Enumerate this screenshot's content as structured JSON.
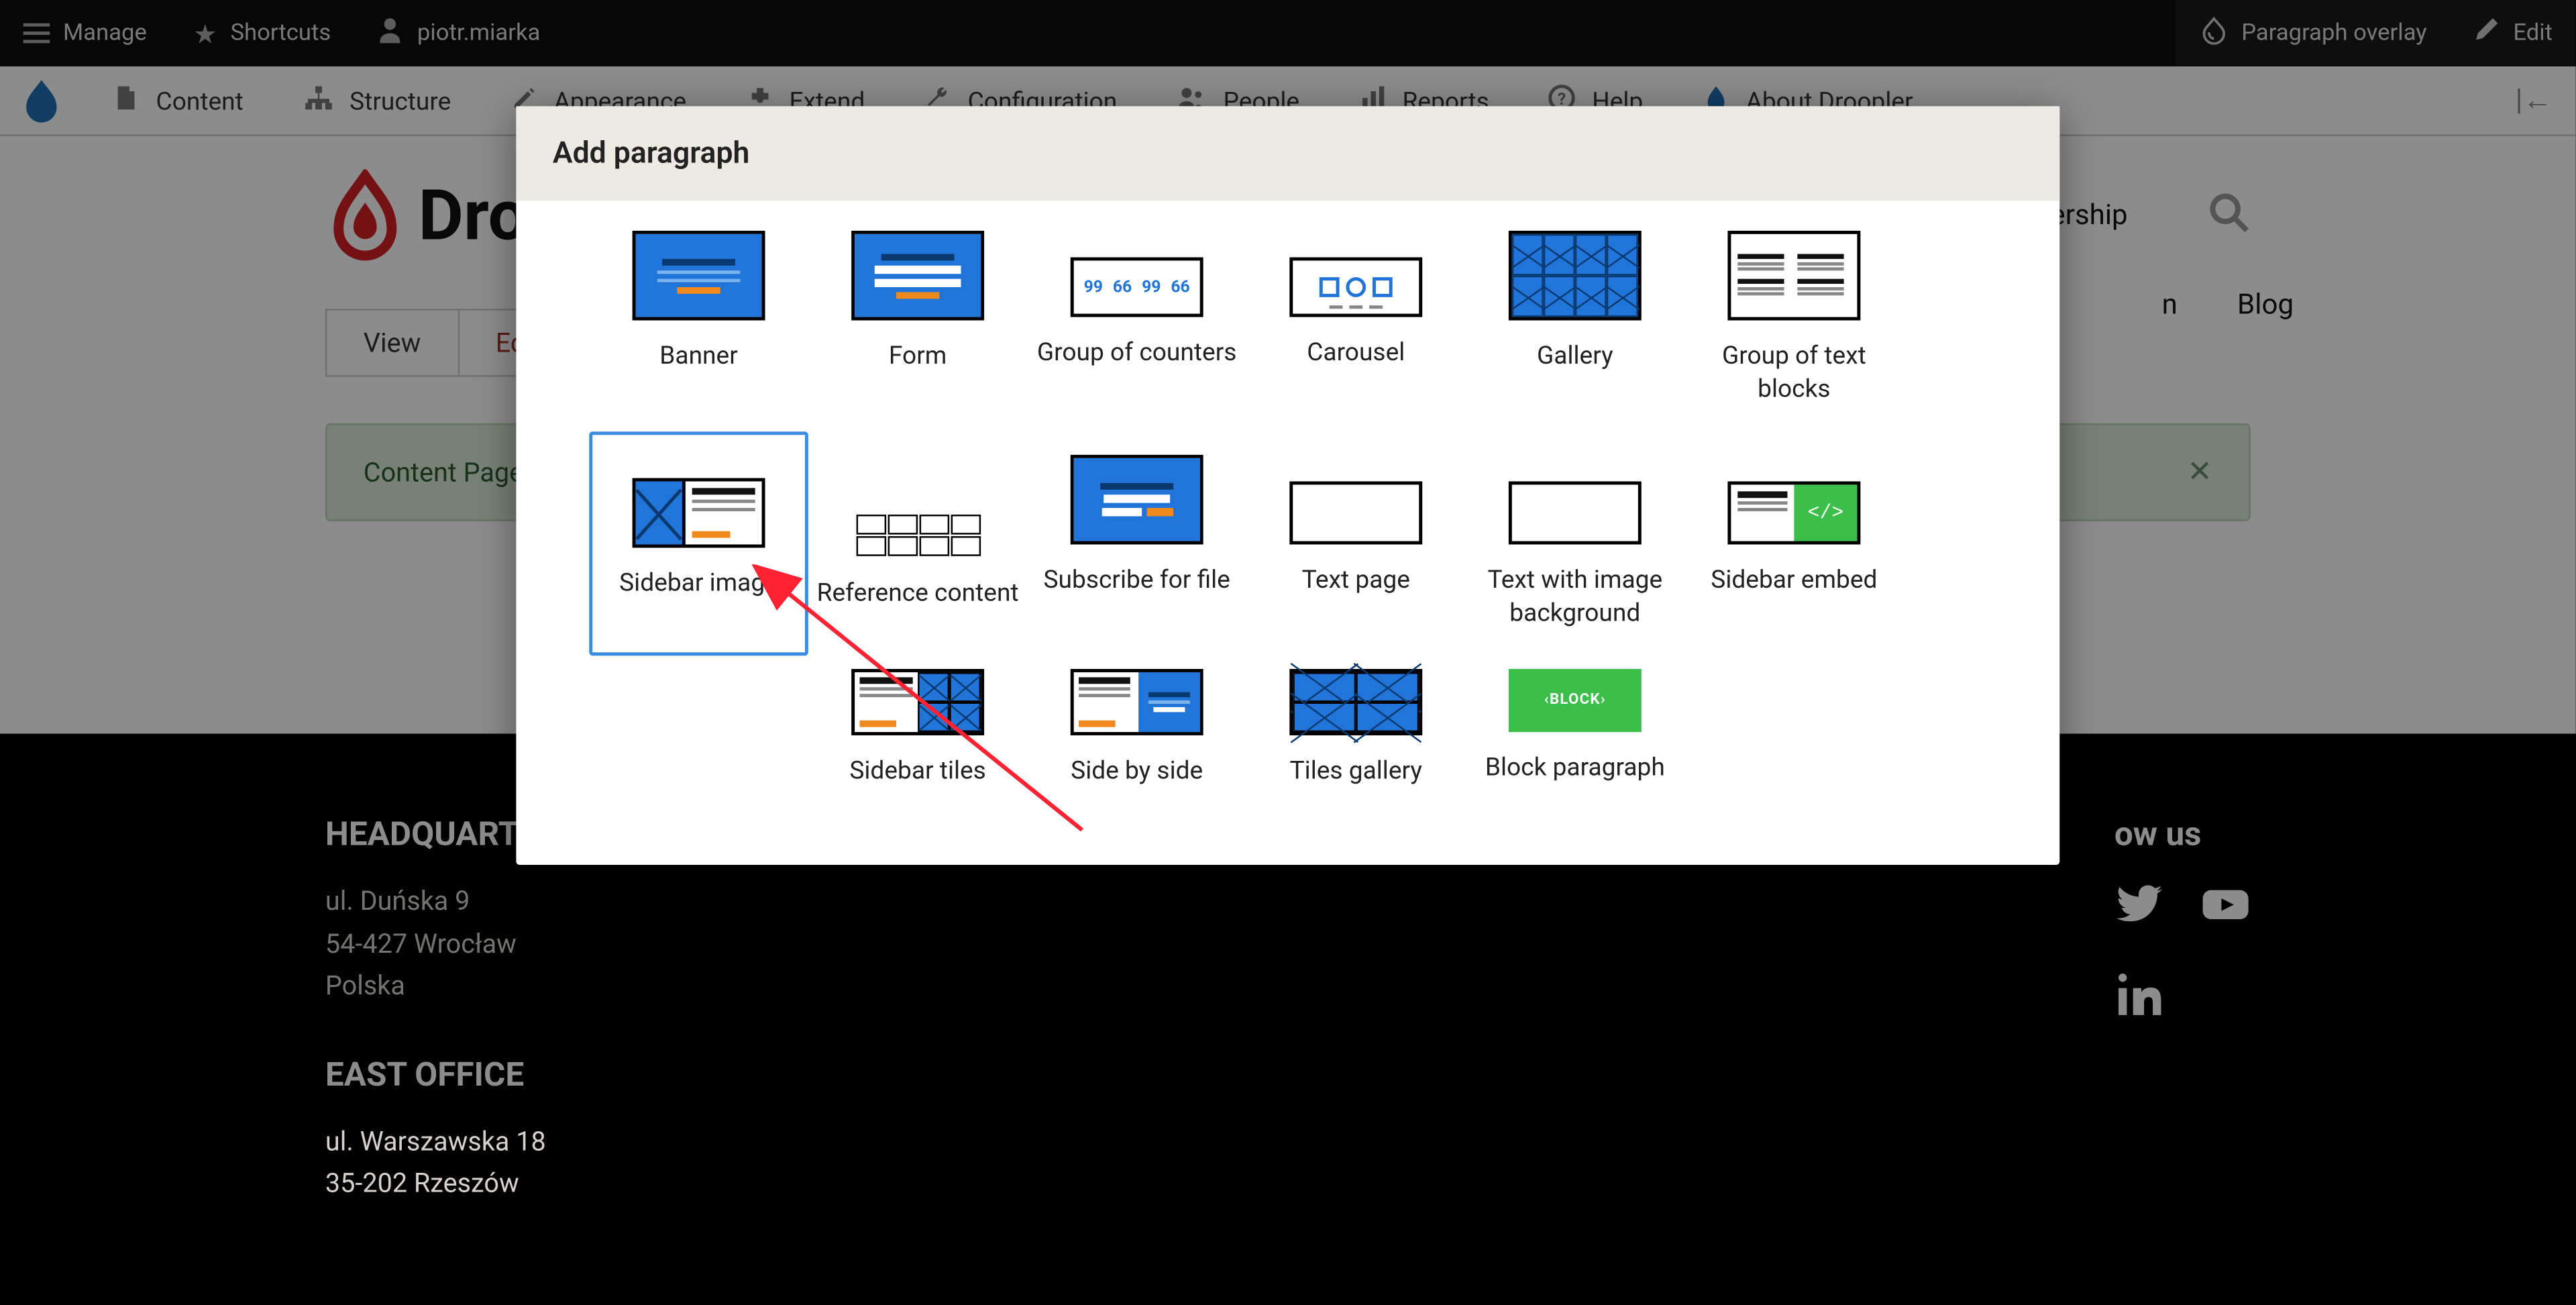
{
  "toolbar": {
    "manage": "Manage",
    "shortcuts": "Shortcuts",
    "user": "piotr.miarka",
    "paragraph_overlay": "Paragraph overlay",
    "edit": "Edit"
  },
  "admin_menu": {
    "items": [
      {
        "label": "Content"
      },
      {
        "label": "Structure"
      },
      {
        "label": "Appearance"
      },
      {
        "label": "Extend"
      },
      {
        "label": "Configuration"
      },
      {
        "label": "People"
      },
      {
        "label": "Reports"
      },
      {
        "label": "Help"
      },
      {
        "label": "About Droopler"
      }
    ]
  },
  "site": {
    "logo_text": "Dro",
    "nav": [
      {
        "label": "ership"
      },
      {
        "label": "Blog"
      }
    ],
    "tabs": {
      "view": "View",
      "edit": "Edi"
    },
    "status_message": "Content Page",
    "footer": {
      "hq_title": "HEADQUARTER",
      "hq_addr1": "ul. Duńska 9",
      "hq_addr2": "54-427 Wrocław",
      "hq_addr3": "Polska",
      "east_title": "EAST OFFICE",
      "east_addr1": "ul. Warszawska 18",
      "east_addr2": "35-202 Rzeszów",
      "follow_title": "ow us"
    }
  },
  "modal": {
    "title": "Add paragraph",
    "paragraphs": [
      {
        "label": "Banner"
      },
      {
        "label": "Form"
      },
      {
        "label": "Group of counters"
      },
      {
        "label": "Carousel"
      },
      {
        "label": "Gallery"
      },
      {
        "label": "Group of text blocks"
      },
      {
        "label": "Sidebar image",
        "selected": true
      },
      {
        "label": "Reference content"
      },
      {
        "label": "Subscribe for file"
      },
      {
        "label": "Text page"
      },
      {
        "label": "Text with image background"
      },
      {
        "label": "Sidebar embed"
      },
      {
        "label": "Sidebar tiles"
      },
      {
        "label": "Side by side"
      },
      {
        "label": "Tiles gallery"
      },
      {
        "label": "Block paragraph"
      }
    ],
    "block_text": "BLOCK",
    "embed_text": "</>"
  }
}
